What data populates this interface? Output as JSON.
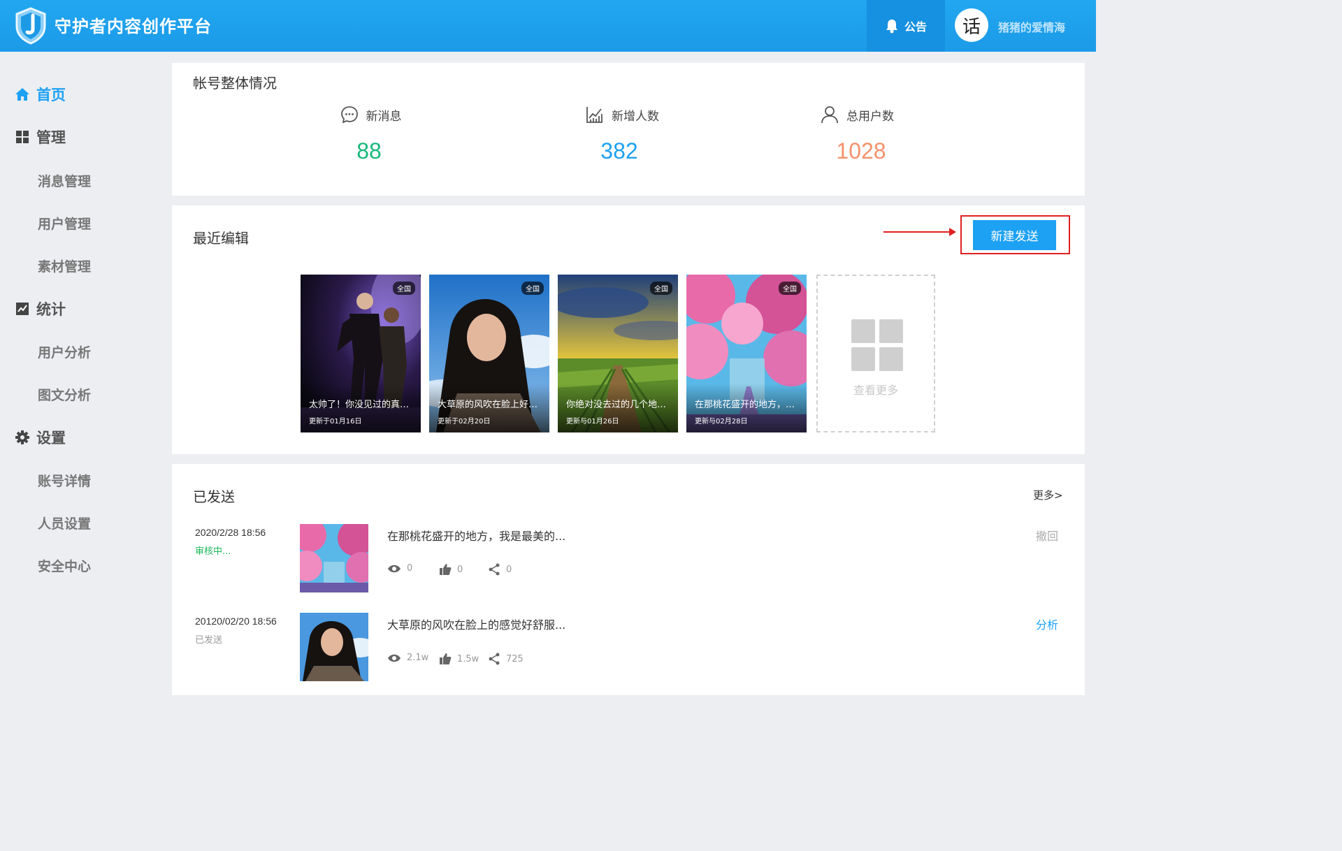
{
  "header": {
    "app_title": "守护者内容创作平台",
    "notice_label": "公告",
    "avatar_char": "话",
    "username": "猪猪的爱情海",
    "colors": {
      "primary": "#1da1f2",
      "header_dark": "#1690e0"
    }
  },
  "sidebar": {
    "groups": [
      {
        "label": "首页",
        "icon": "home-icon",
        "active": true
      },
      {
        "label": "管理",
        "icon": "grid-icon"
      },
      {
        "label": "统计",
        "icon": "chart-icon"
      },
      {
        "label": "设置",
        "icon": "gear-icon"
      }
    ],
    "manage_items": [
      "消息管理",
      "用户管理",
      "素材管理"
    ],
    "stats_items": [
      "用户分析",
      "图文分析"
    ],
    "settings_items": [
      "账号详情",
      "人员设置",
      "安全中心"
    ]
  },
  "overview": {
    "title": "帐号整体情况",
    "stats": [
      {
        "label": "新消息",
        "value": "88",
        "icon": "message-icon",
        "color": "#19b87a"
      },
      {
        "label": "新增人数",
        "value": "382",
        "icon": "growth-chart-icon",
        "color": "#1da1f2"
      },
      {
        "label": "总用户数",
        "value": "1028",
        "icon": "user-icon",
        "color": "#f4916b"
      }
    ]
  },
  "recent": {
    "title": "最近编辑",
    "new_button": "新建发送",
    "cards": [
      {
        "title": "太帅了！你没见过的真舞...",
        "date": "更新于01月16日",
        "badge": "全国"
      },
      {
        "title": "大草原的风吹在脸上好舒...",
        "date": "更新于02月20日",
        "badge": "全国"
      },
      {
        "title": "你绝对没去过的几个地方...",
        "date": "更新与01月26日",
        "badge": "全国"
      },
      {
        "title": "在那桃花盛开的地方，我...",
        "date": "更新与02月28日",
        "badge": "全国"
      }
    ],
    "more_label": "查看更多"
  },
  "sent": {
    "title": "已发送",
    "more_link": "更多>",
    "items": [
      {
        "date": "2020/2/28 18:56",
        "status": "审核中...",
        "status_color": "#19b85a",
        "title": "在那桃花盛开的地方，我是最美的...",
        "views": "0",
        "likes": "0",
        "shares": "0",
        "action": "撤回",
        "action_color": "#aaaaaa"
      },
      {
        "date": "20120/02/20 18:56",
        "status": "已发送",
        "status_color": "#999999",
        "title": "大草原的风吹在脸上的感觉好舒服...",
        "views": "2.1w",
        "likes": "1.5w",
        "shares": "725",
        "action": "分析",
        "action_color": "#1da1f2"
      }
    ]
  }
}
